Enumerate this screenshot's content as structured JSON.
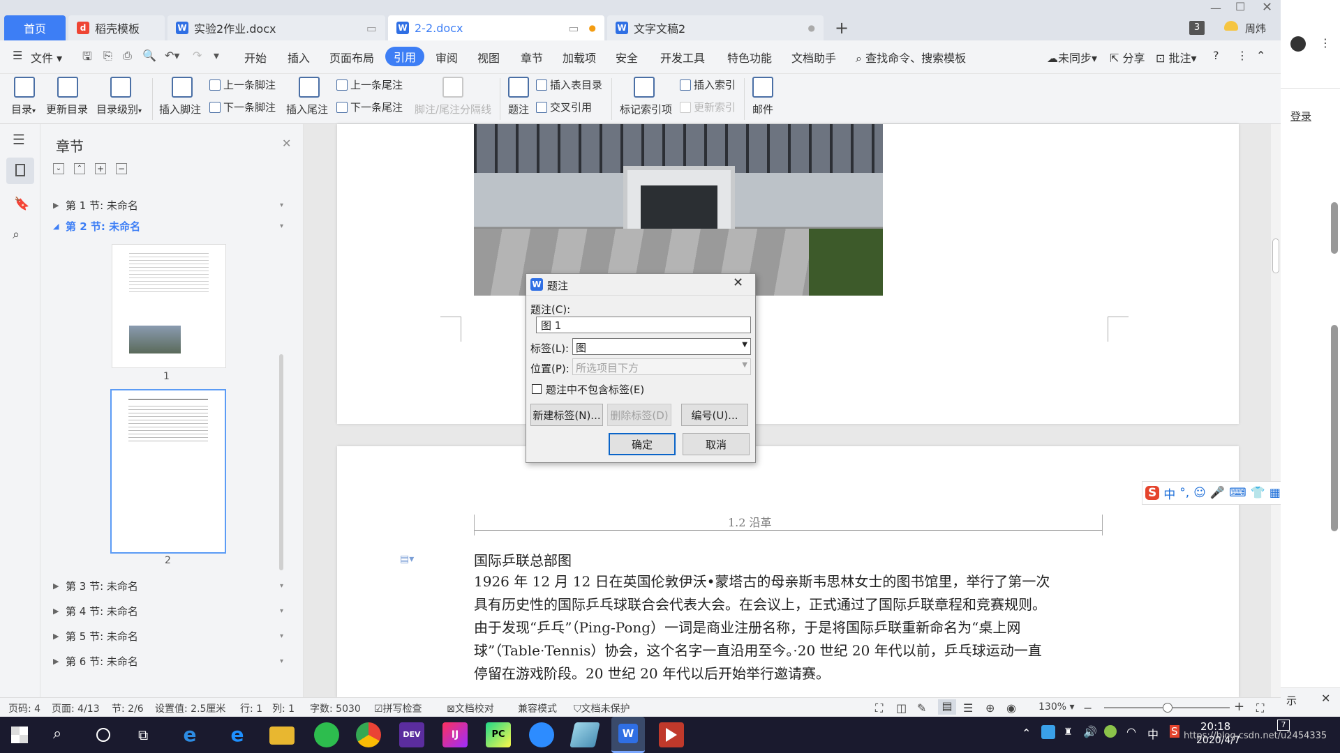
{
  "tabs": {
    "home": "首页",
    "template": "稻壳模板",
    "doc1": "实验2作业.docx",
    "doc2": "2-2.docx",
    "doc3": "文字文稿2",
    "count": "3",
    "user": "周炜"
  },
  "menu": {
    "file": "文件",
    "items": [
      "开始",
      "插入",
      "页面布局",
      "引用",
      "审阅",
      "视图",
      "章节",
      "加载项",
      "安全",
      "开发工具",
      "特色功能",
      "文档助手"
    ],
    "search": "查找命令、搜索模板",
    "sync": "未同步",
    "share": "分享",
    "comment": "批注"
  },
  "ribbon": {
    "toc": "目录",
    "update_toc": "更新目录",
    "toc_level": "目录级别",
    "insert_footnote": "插入脚注",
    "prev_footnote": "上一条脚注",
    "next_footnote": "下一条脚注",
    "insert_endnote": "插入尾注",
    "prev_endnote": "上一条尾注",
    "next_endnote": "下一条尾注",
    "separator": "脚注/尾注分隔线",
    "caption": "题注",
    "insert_tof": "插入表目录",
    "cross_ref": "交叉引用",
    "mark_index": "标记索引项",
    "insert_index": "插入索引",
    "update_index": "更新索引",
    "mail": "邮件"
  },
  "nav": {
    "title": "章节",
    "sections": [
      "第 1 节: 未命名",
      "第 2 节: 未命名",
      "第 3 节: 未命名",
      "第 4 节: 未命名",
      "第 5 节: 未命名",
      "第 6 节: 未命名"
    ],
    "page1": "1",
    "page2": "2"
  },
  "document": {
    "header_text": "1.2 沿革",
    "p1": "国际乒联总部图",
    "p2_lines": [
      "1926 年 12 月 12 日在英国伦敦伊沃•蒙塔古的母亲斯韦思林女士的图书馆里，举行了第一次",
      "具有历史性的国际乒乓球联合会代表大会。在会议上，正式通过了国际乒联章程和竞赛规则。",
      "由于发现“乒乓”（Ping-Pong）一词是商业注册名称，于是将国际乒联重新命名为“桌上网",
      "球”（Table·Tennis）协会，这个名字一直沿用至今。·20 世纪 20 年代以前，乒乓球运动一直",
      "停留在游戏阶段。20 世纪 20 年代以后开始举行邀请赛。"
    ]
  },
  "dialog": {
    "title": "题注",
    "caption_label": "题注(C):",
    "caption_value": "图 1",
    "label_label": "标签(L):",
    "label_value": "图",
    "position_label": "位置(P):",
    "position_value": "所选项目下方",
    "exclude_label": "题注中不包含标签(E)",
    "new_label": "新建标签(N)...",
    "delete_label": "删除标签(D)",
    "numbering": "编号(U)...",
    "ok": "确定",
    "cancel": "取消"
  },
  "status": {
    "page_no": "页码: 4",
    "page": "页面: 4/13",
    "section": "节: 2/6",
    "setting": "设置值: 2.5厘米",
    "row": "行: 1",
    "col": "列: 1",
    "words": "字数: 5030",
    "spell": "拼写检查",
    "proof": "文档校对",
    "compat": "兼容模式",
    "protect": "文档未保护",
    "zoom": "130%"
  },
  "side": {
    "login": "登录",
    "tip": "示"
  },
  "taskbar": {
    "time": "20:18",
    "date": "2020/4/7",
    "ime": "中",
    "url": "https://blog.csdn.net/u2454335",
    "notif": "7"
  },
  "ime_bar": "中"
}
